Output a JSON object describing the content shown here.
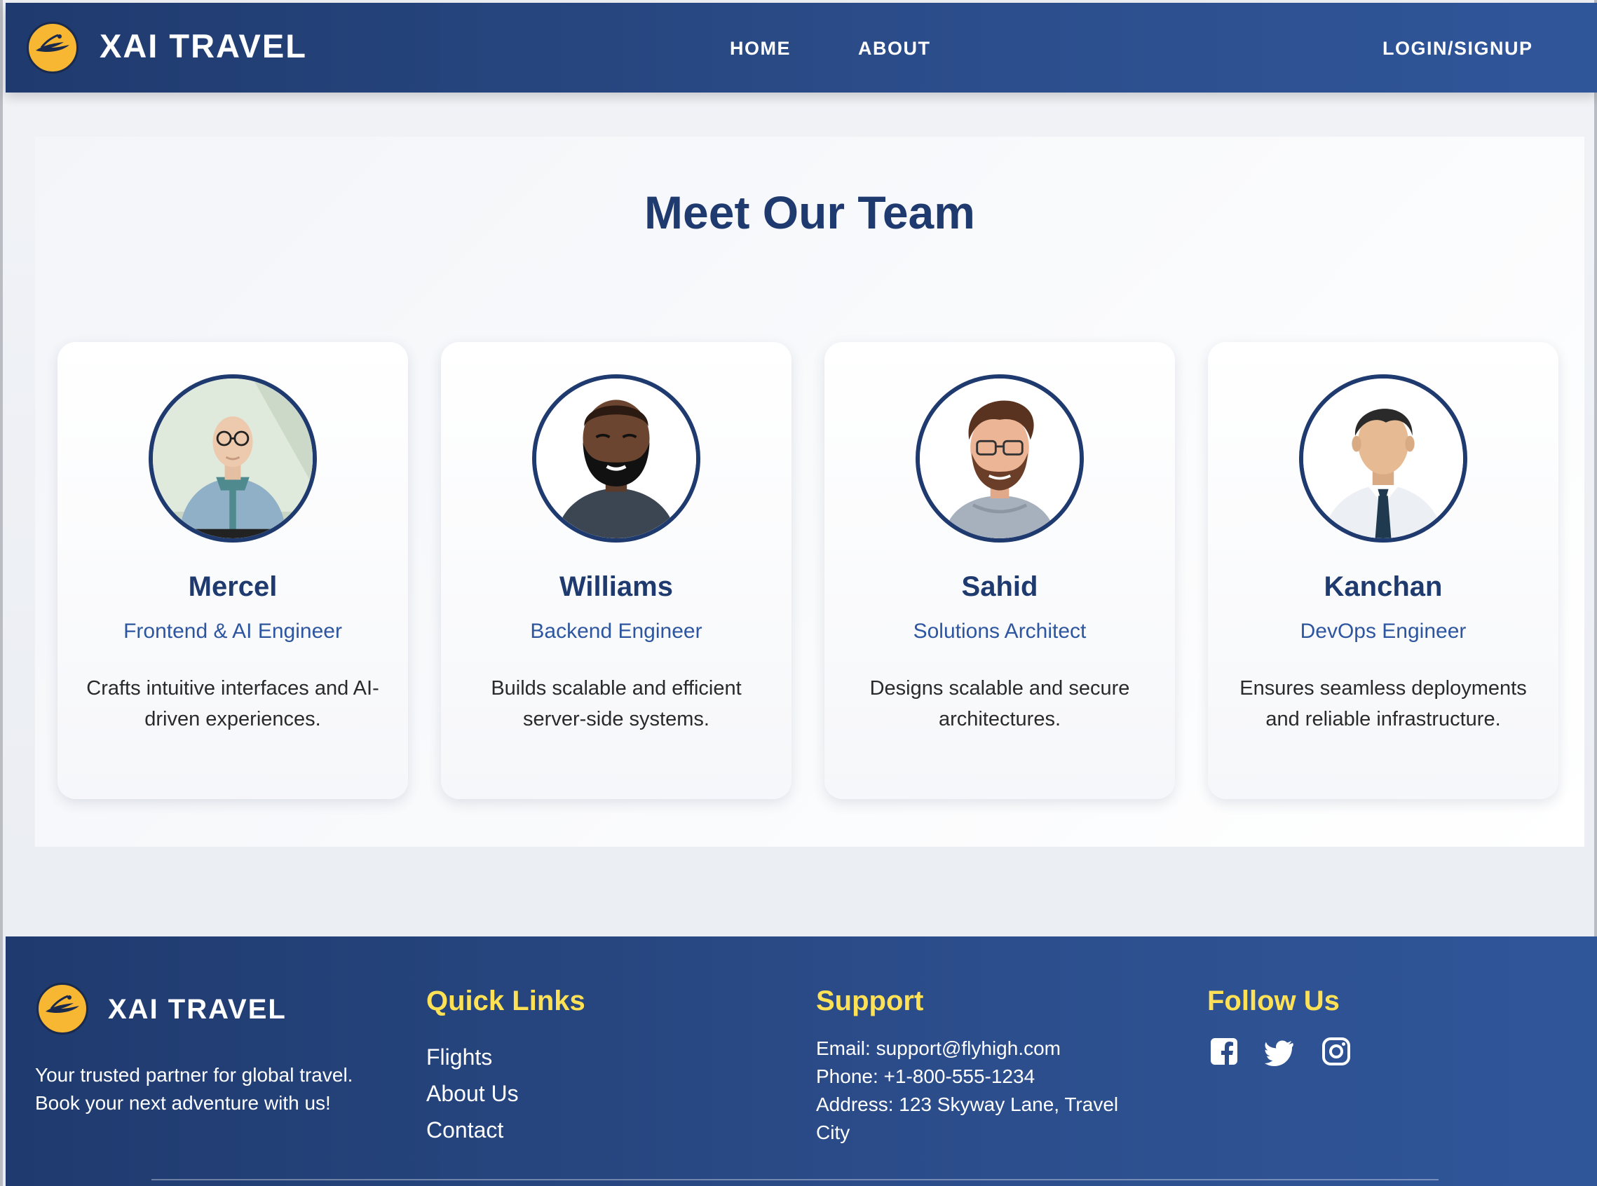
{
  "navbar": {
    "brand": "XAI TRAVEL",
    "links": [
      "HOME",
      "ABOUT"
    ],
    "login": "LOGIN/SIGNUP"
  },
  "team": {
    "title": "Meet Our Team",
    "members": [
      {
        "name": "Mercel",
        "role": "Frontend & AI Engineer",
        "desc": "Crafts intuitive interfaces and AI-driven experiences."
      },
      {
        "name": "Williams",
        "role": "Backend Engineer",
        "desc": "Builds scalable and efficient server-side systems."
      },
      {
        "name": "Sahid",
        "role": "Solutions Architect",
        "desc": "Designs scalable and secure architectures."
      },
      {
        "name": "Kanchan",
        "role": "DevOps Engineer",
        "desc": "Ensures seamless deployments and reliable infrastructure."
      }
    ]
  },
  "footer": {
    "brand": "XAI TRAVEL",
    "tagline": "Your trusted partner for global travel. Book your next adventure with us!",
    "quick_links_heading": "Quick Links",
    "quick_links": [
      "Flights",
      "About Us",
      "Contact"
    ],
    "support_heading": "Support",
    "support": {
      "email": "Email: support@flyhigh.com",
      "phone": "Phone: +1-800-555-1234",
      "address": "Address: 123 Skyway Lane, Travel City"
    },
    "follow_heading": "Follow Us",
    "social_icons": [
      "facebook-icon",
      "twitter-icon",
      "instagram-icon"
    ]
  },
  "colors": {
    "navy": "#1f3a6e",
    "accent_blue": "#2e56a0",
    "logo_yellow": "#f7b733",
    "footer_heading": "#ffe155"
  }
}
